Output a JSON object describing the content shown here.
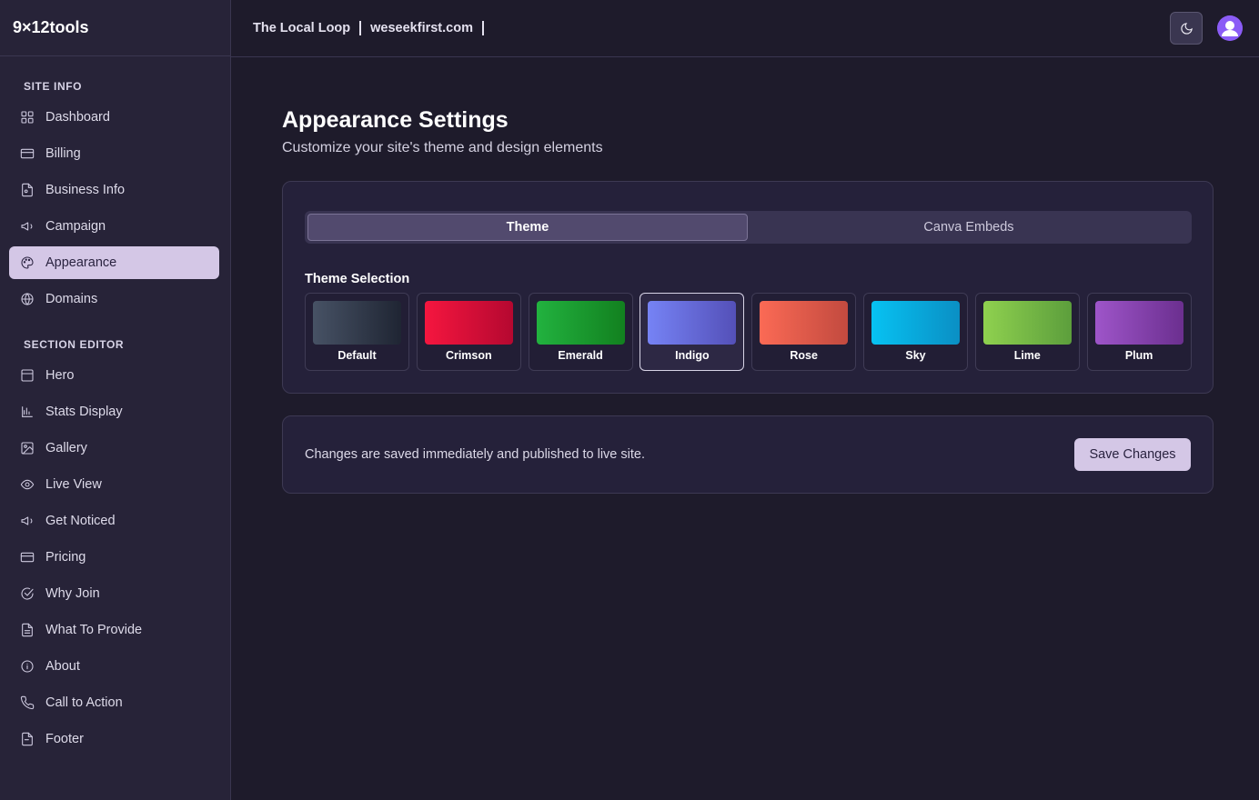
{
  "brand": "9×12tools",
  "topbar": {
    "site_name": "The Local Loop",
    "domain": "weseekfirst.com",
    "theme_toggle_icon": "moon-icon",
    "avatar_icon": "user-avatar-icon"
  },
  "sidebar": {
    "site_info_label": "SITE INFO",
    "site_info_items": [
      {
        "label": "Dashboard",
        "icon": "dashboard-icon"
      },
      {
        "label": "Billing",
        "icon": "credit-card-icon"
      },
      {
        "label": "Business Info",
        "icon": "document-icon"
      },
      {
        "label": "Campaign",
        "icon": "megaphone-icon"
      },
      {
        "label": "Appearance",
        "icon": "palette-icon",
        "active": true
      },
      {
        "label": "Domains",
        "icon": "globe-icon"
      }
    ],
    "section_editor_label": "SECTION EDITOR",
    "section_editor_items": [
      {
        "label": "Hero",
        "icon": "layout-icon"
      },
      {
        "label": "Stats Display",
        "icon": "bar-chart-icon"
      },
      {
        "label": "Gallery",
        "icon": "image-icon"
      },
      {
        "label": "Live View",
        "icon": "eye-icon"
      },
      {
        "label": "Get Noticed",
        "icon": "megaphone-icon"
      },
      {
        "label": "Pricing",
        "icon": "credit-card-icon"
      },
      {
        "label": "Why Join",
        "icon": "check-circle-icon"
      },
      {
        "label": "What To Provide",
        "icon": "file-text-icon"
      },
      {
        "label": "About",
        "icon": "info-icon"
      },
      {
        "label": "Call to Action",
        "icon": "phone-icon"
      },
      {
        "label": "Footer",
        "icon": "file-icon"
      }
    ]
  },
  "main": {
    "title": "Appearance Settings",
    "subtitle": "Customize your site's theme and design elements",
    "tabs": [
      {
        "label": "Theme",
        "active": true
      },
      {
        "label": "Canva Embeds",
        "active": false
      }
    ],
    "theme_selection_label": "Theme Selection",
    "themes": [
      {
        "name": "Default",
        "from": "#475265",
        "to": "#1f2533"
      },
      {
        "name": "Crimson",
        "from": "#f5163f",
        "to": "#b50830"
      },
      {
        "name": "Emerald",
        "from": "#22b23f",
        "to": "#12801f"
      },
      {
        "name": "Indigo",
        "from": "#7683f5",
        "to": "#5450b8",
        "selected": true
      },
      {
        "name": "Rose",
        "from": "#fb6a55",
        "to": "#c24a3f"
      },
      {
        "name": "Sky",
        "from": "#07c2f2",
        "to": "#0a8fc4"
      },
      {
        "name": "Lime",
        "from": "#8fd14f",
        "to": "#5c9e3c"
      },
      {
        "name": "Plum",
        "from": "#9e55c9",
        "to": "#6b2f8f"
      }
    ],
    "save_note": "Changes are saved immediately and published to live site.",
    "save_label": "Save Changes"
  },
  "colors": {
    "accent": "#d4c7e6",
    "background": "#1e1b2b",
    "sidebar": "#272338"
  }
}
